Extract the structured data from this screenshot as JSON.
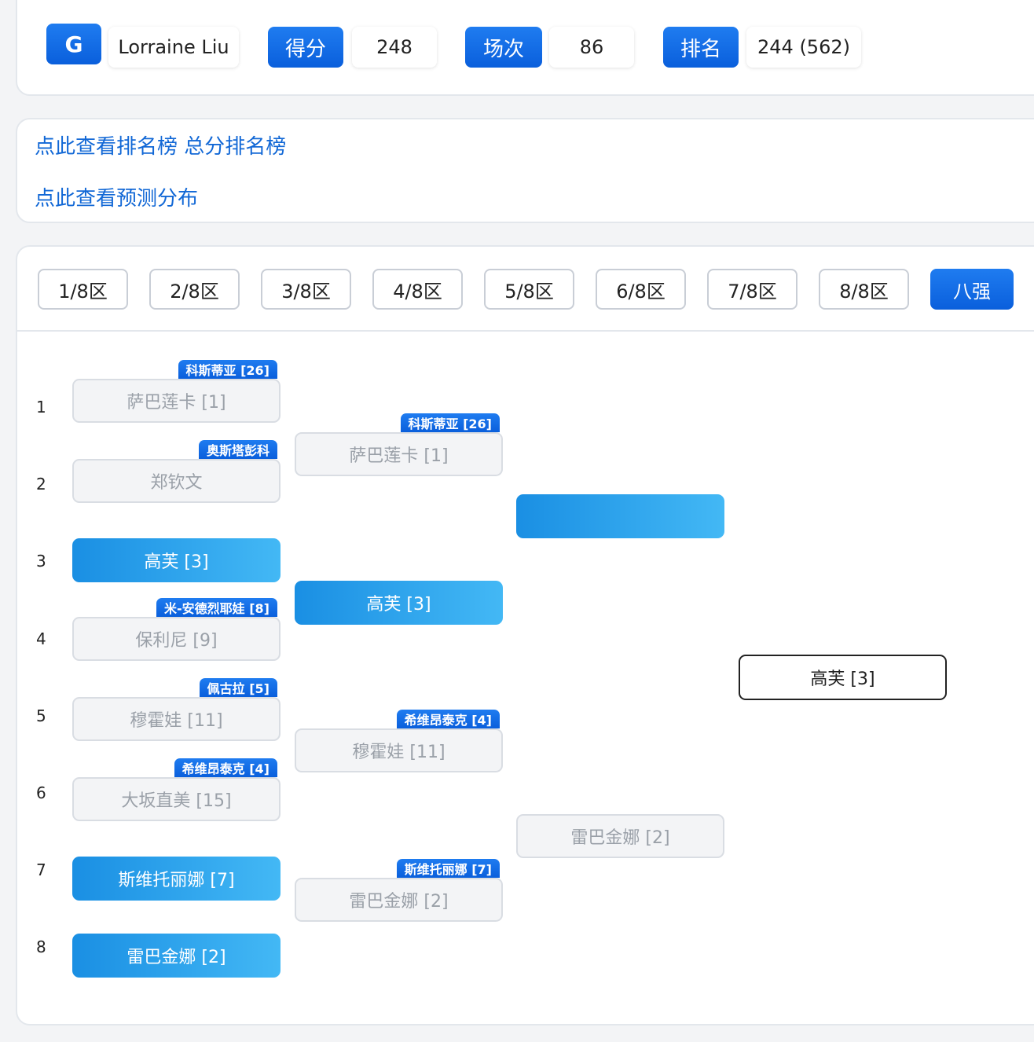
{
  "header": {
    "badge": "G",
    "user_name": "Lorraine Liu",
    "stats": [
      {
        "label": "得分",
        "value": "248"
      },
      {
        "label": "场次",
        "value": "86"
      },
      {
        "label": "排名",
        "value": "244 (562)"
      }
    ]
  },
  "links": {
    "ranking": "点此查看排名榜 总分排名榜",
    "distribution": "点此查看预测分布"
  },
  "tabs": [
    "1/8区",
    "2/8区",
    "3/8区",
    "4/8区",
    "5/8区",
    "6/8区",
    "7/8区",
    "8/8区",
    "八强"
  ],
  "active_tab": "八强",
  "bracket": {
    "seeds": [
      "1",
      "2",
      "3",
      "4",
      "5",
      "6",
      "7",
      "8"
    ],
    "round1": [
      {
        "player": "萨巴莲卡 [1]",
        "tag": "科斯蒂亚 [26]",
        "style": "gray"
      },
      {
        "player": "郑钦文",
        "tag": "奥斯塔彭科",
        "style": "gray"
      },
      {
        "player": "高芙 [3]",
        "tag": "",
        "style": "blue"
      },
      {
        "player": "保利尼 [9]",
        "tag": "米-安德烈耶娃 [8]",
        "style": "gray"
      },
      {
        "player": "穆霍娃 [11]",
        "tag": "佩古拉 [5]",
        "style": "gray"
      },
      {
        "player": "大坂直美 [15]",
        "tag": "希维昂泰克 [4]",
        "style": "gray"
      },
      {
        "player": "斯维托丽娜 [7]",
        "tag": "",
        "style": "blue"
      },
      {
        "player": "雷巴金娜 [2]",
        "tag": "",
        "style": "blue"
      }
    ],
    "round2": [
      {
        "player": "萨巴莲卡 [1]",
        "tag": "科斯蒂亚 [26]",
        "style": "gray"
      },
      {
        "player": "高芙 [3]",
        "tag": "",
        "style": "blue"
      },
      {
        "player": "穆霍娃 [11]",
        "tag": "希维昂泰克 [4]",
        "style": "gray"
      },
      {
        "player": "雷巴金娜 [2]",
        "tag": "斯维托丽娜 [7]",
        "style": "gray"
      }
    ],
    "round3": [
      {
        "player": "",
        "tag": "",
        "style": "blue"
      },
      {
        "player": "雷巴金娜 [2]",
        "tag": "",
        "style": "gray"
      }
    ],
    "final": {
      "player": "高芙 [3]",
      "style": "outline"
    }
  }
}
